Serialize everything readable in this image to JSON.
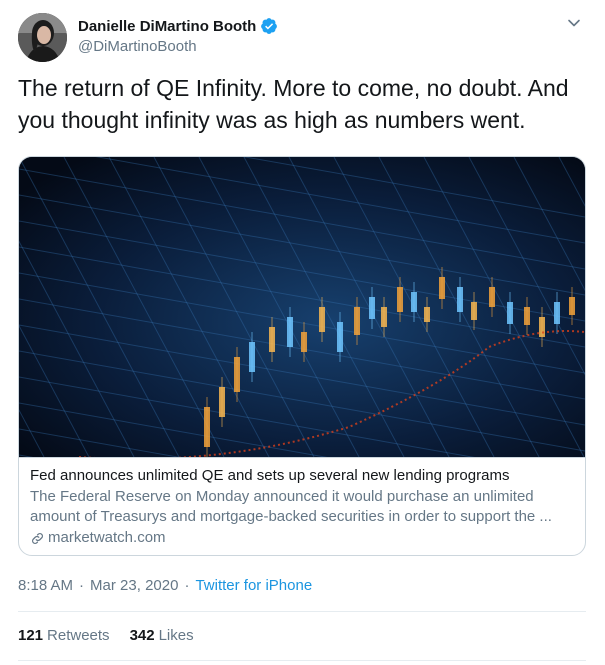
{
  "author": {
    "display_name": "Danielle DiMartino Booth",
    "handle": "@DiMartinoBooth",
    "verified": true,
    "avatar_icon": "profile-photo"
  },
  "tweet": {
    "text": "The return of QE Infinity. More to come, no doubt. And you thought infinity was as high as numbers went."
  },
  "card": {
    "image_icon": "stock-chart-image",
    "title": "Fed announces unlimited QE and sets up several new lending programs",
    "description_line1": "The Federal Reserve on Monday announced it would purchase an unlimited",
    "description_line2": "amount of Treasurys and mortgage-backed securities in order to support the ...",
    "domain": "marketwatch.com",
    "link_icon": "link-icon"
  },
  "meta": {
    "time": "8:18 AM",
    "separator": "·",
    "date": "Mar 23, 2020",
    "source": "Twitter for iPhone"
  },
  "stats": {
    "retweets_count": "121",
    "retweets_label": "Retweets",
    "likes_count": "342",
    "likes_label": "Likes"
  },
  "colors": {
    "link_blue": "#1b95e0",
    "verified_blue": "#1da1f2",
    "secondary_text": "#657786",
    "border": "#ccd6dd"
  }
}
